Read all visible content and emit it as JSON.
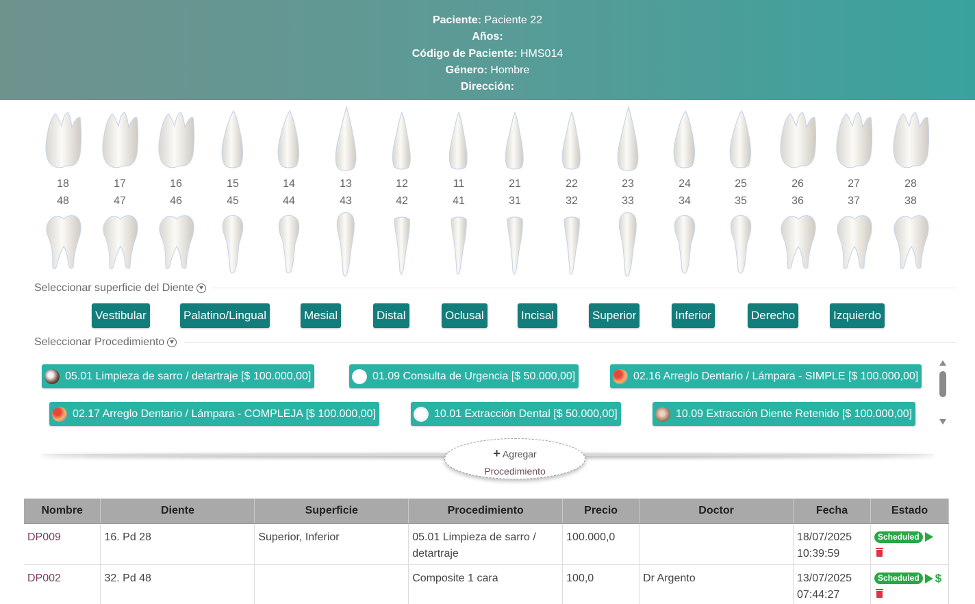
{
  "patient": {
    "name_label": "Paciente:",
    "name_value": " Paciente 22",
    "age_label": "Años:",
    "age_value": "",
    "code_label": "Código de Paciente:",
    "code_value": " HMS014",
    "gender_label": "Género:",
    "gender_value": " Hombre",
    "address_label": "Dirección:",
    "address_value": ""
  },
  "teeth": {
    "upper": [
      "18",
      "17",
      "16",
      "15",
      "14",
      "13",
      "12",
      "11",
      "21",
      "22",
      "23",
      "24",
      "25",
      "26",
      "27",
      "28"
    ],
    "lower": [
      "48",
      "47",
      "46",
      "45",
      "44",
      "43",
      "42",
      "41",
      "31",
      "32",
      "33",
      "34",
      "35",
      "36",
      "37",
      "38"
    ]
  },
  "surface_section": {
    "title": "Seleccionar superficie del Diente",
    "buttons": [
      "Vestibular",
      "Palatino/Lingual",
      "Mesial",
      "Distal",
      "Oclusal",
      "Incisal",
      "Superior",
      "Inferior",
      "Derecho",
      "Izquierdo"
    ]
  },
  "procedure_section": {
    "title": "Seleccionar Procedimiento",
    "items": [
      {
        "label": "05.01 Limpieza de sarro / detartraje [$ 100.000,00]",
        "icon": "cleaning-icon"
      },
      {
        "label": "01.09 Consulta de Urgencia [$ 50.000,00]",
        "icon": "consultation-icon"
      },
      {
        "label": "02.16 Arreglo Dentario / Lámpara - SIMPLE [$ 100.000,00]",
        "icon": "filling-icon"
      },
      {
        "label": "02.17 Arreglo Dentario / Lámpara - COMPLEJA [$ 100.000,00]",
        "icon": "filling-complex-icon"
      },
      {
        "label": "10.01 Extracción Dental [$ 50.000,00]",
        "icon": "extraction-icon"
      },
      {
        "label": "10.09 Extracción Diente Retenido [$ 100.000,00]",
        "icon": "retained-tooth-icon"
      }
    ]
  },
  "add_button": {
    "line1": "Agregar",
    "line2": "Procedimiento"
  },
  "table": {
    "headers": [
      "Nombre",
      "Diente",
      "Superficie",
      "Procedimiento",
      "Precio",
      "Doctor",
      "Fecha",
      "Estado"
    ],
    "rows": [
      {
        "name": "DP009",
        "tooth": "16. Pd 28",
        "surface": "Superior, Inferior",
        "procedure": "05.01 Limpieza de sarro / detartraje",
        "price": "100.000,0",
        "doctor": "",
        "date": "18/07/2025",
        "time": "10:39:59",
        "status": "Scheduled"
      },
      {
        "name": "DP002",
        "tooth": "32. Pd 48",
        "surface": "",
        "procedure": "Composite 1 cara",
        "price": "100,0",
        "doctor": "Dr Argento",
        "date": "13/07/2025",
        "time": "07:44:27",
        "status": "Scheduled"
      }
    ]
  },
  "colors": {
    "header_start": "#6f928d",
    "header_end": "#3aa29d",
    "surface_btn": "#137d7b",
    "procedure_btn": "#2ab2a5",
    "status_badge": "#28a745",
    "delete_icon": "#dc3545"
  }
}
